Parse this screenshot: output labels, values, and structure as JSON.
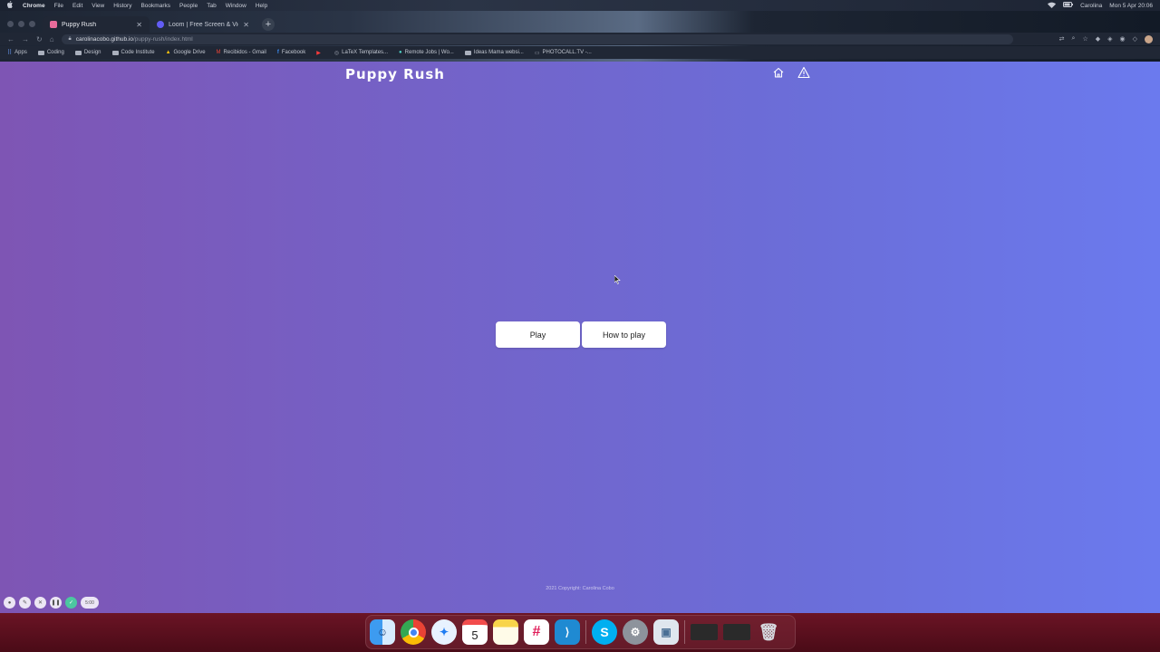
{
  "menubar": {
    "apple": "",
    "app_name": "Chrome",
    "menus": [
      "File",
      "Edit",
      "View",
      "History",
      "Bookmarks",
      "People",
      "Tab",
      "Window",
      "Help"
    ],
    "user": "Carolina",
    "datetime": "Mon 5 Apr 20:06"
  },
  "browser": {
    "tabs": [
      {
        "title": "Puppy Rush",
        "active": true
      },
      {
        "title": "Loom | Free Screen & Video Re",
        "active": false
      }
    ],
    "new_tab": "+",
    "url_host": "carolinacobo.github.io",
    "url_path": "/puppy-rush/index.html",
    "bookmarks": [
      {
        "label": "Apps",
        "icon": "apps-grid-icon"
      },
      {
        "label": "Coding",
        "icon": "folder-icon"
      },
      {
        "label": "Design",
        "icon": "folder-icon"
      },
      {
        "label": "Code Institute",
        "icon": "folder-icon"
      },
      {
        "label": "Google Drive",
        "icon": "drive-icon"
      },
      {
        "label": "Recibidos - Gmail",
        "icon": "gmail-icon"
      },
      {
        "label": "Facebook",
        "icon": "facebook-icon"
      },
      {
        "label": "",
        "icon": "youtube-icon"
      },
      {
        "label": "LaTeX Templates...",
        "icon": "latex-icon"
      },
      {
        "label": "Remote Jobs | Wo...",
        "icon": "remote-icon"
      },
      {
        "label": "Ideas Mama websi...",
        "icon": "folder-icon"
      },
      {
        "label": "PHOTOCALL.TV -...",
        "icon": "tv-icon"
      }
    ]
  },
  "page": {
    "title": "Puppy Rush",
    "play_label": "Play",
    "howto_label": "How to play",
    "footer": "2021 Copyright: Carolina Cobo"
  },
  "loom": {
    "timer": "5:00"
  },
  "colors": {
    "gradient_start": "#7e55b4",
    "gradient_end": "#6b7aee",
    "button_bg": "#ffffff"
  }
}
